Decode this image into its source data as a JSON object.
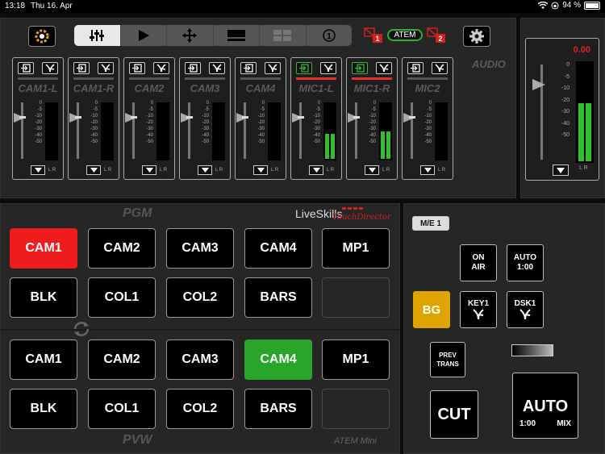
{
  "status_bar": {
    "time": "13:18",
    "date": "Thu 16. Apr",
    "battery": "94 %"
  },
  "toolbar": {
    "tabs": [
      "mixer-icon",
      "play-icon",
      "move-icon",
      "monitor-icon",
      "multiview-icon",
      "info-icon"
    ],
    "info_label": "1",
    "atem_label": "ATEM",
    "red_badge_1": "1",
    "red_badge_2": "2"
  },
  "audio": {
    "label": "AUDIO",
    "scale": [
      "0",
      "-5",
      "-10",
      "-20",
      "-30",
      "-40",
      "-50"
    ],
    "lr": "L R",
    "channels": [
      {
        "name": "CAM1-L",
        "live": false,
        "meter": [
          0,
          0
        ]
      },
      {
        "name": "CAM1-R",
        "live": false,
        "meter": [
          0,
          0
        ]
      },
      {
        "name": "CAM2",
        "live": false,
        "meter": [
          0,
          0
        ]
      },
      {
        "name": "CAM3",
        "live": false,
        "meter": [
          0,
          0
        ]
      },
      {
        "name": "CAM4",
        "live": false,
        "meter": [
          0,
          0
        ]
      },
      {
        "name": "MIC1-L",
        "live": true,
        "meter": [
          0.45,
          0.45
        ]
      },
      {
        "name": "MIC1-R",
        "live": true,
        "meter": [
          0.5,
          0.5
        ]
      },
      {
        "name": "MIC2",
        "live": false,
        "meter": [
          0,
          0
        ]
      }
    ],
    "master": {
      "value": "0.00",
      "meter": [
        0.6,
        0.6
      ]
    }
  },
  "pgm": {
    "label": "PGM",
    "buttons": [
      "CAM1",
      "CAM2",
      "CAM3",
      "CAM4",
      "MP1",
      "BLK",
      "COL1",
      "COL2",
      "BARS",
      ""
    ],
    "active": 0
  },
  "pvw": {
    "label": "PVW",
    "buttons": [
      "CAM1",
      "CAM2",
      "CAM3",
      "CAM4",
      "MP1",
      "BLK",
      "COL1",
      "COL2",
      "BARS",
      ""
    ],
    "active": 3
  },
  "brand": {
    "name": "LiveSkills",
    "sub": "TouchDirector",
    "model": "ATEM Mini"
  },
  "me": {
    "tag": "M/E 1",
    "on_air": [
      "ON",
      "AIR"
    ],
    "auto_small": [
      "AUTO",
      "1:00"
    ],
    "bg": "BG",
    "key1": "KEY1",
    "dsk1": "DSK1",
    "prev_trans": [
      "PREV",
      "TRANS"
    ],
    "cut": "CUT",
    "auto": "AUTO",
    "auto_duration": "1:00",
    "auto_type": "MIX"
  },
  "colors": {
    "pgm_active": "#ee1c1c",
    "pvw_active": "#29a529",
    "bg_active": "#e0a400"
  }
}
